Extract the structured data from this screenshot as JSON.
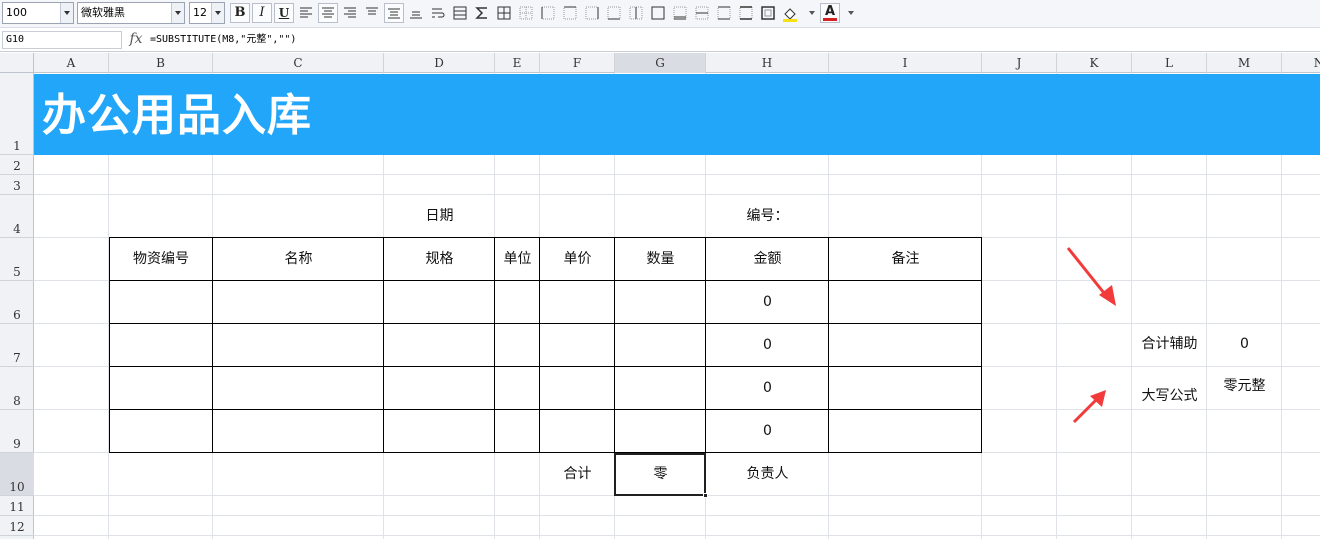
{
  "toolbar": {
    "zoom": "100",
    "font_name": "微软雅黑",
    "font_size": "12",
    "bold_label": "B",
    "italic_label": "I",
    "underline_label": "U",
    "font_color_label": "A"
  },
  "formula_bar": {
    "cell_ref": "G10",
    "fx_label": "fx",
    "formula": "=SUBSTITUTE(M8,\"元整\",\"\")"
  },
  "columns": [
    "A",
    "B",
    "C",
    "D",
    "E",
    "F",
    "G",
    "H",
    "I",
    "J",
    "K",
    "L",
    "M",
    "N"
  ],
  "rows": [
    "1",
    "2",
    "3",
    "4",
    "5",
    "6",
    "7",
    "8",
    "9",
    "10",
    "11",
    "12"
  ],
  "sheet": {
    "title": "办公用品入库",
    "date_label": "日期",
    "number_label": "编号：",
    "headers": [
      "物资编号",
      "名称",
      "规格",
      "单位",
      "单价",
      "数量",
      "金额",
      "备注"
    ],
    "amounts": [
      "0",
      "0",
      "0",
      "0"
    ],
    "total_label": "合计",
    "total_value": "零",
    "person_label": "负责人",
    "helper_label": "合计辅助",
    "helper_value": "0",
    "uppercase_label": "大写公式",
    "uppercase_value": "零元整"
  },
  "colors": {
    "title_band": "#22a6f9",
    "arrow": "#f23a3a",
    "fill_highlight": "#f5e01a",
    "font_color_bar": "#d92020"
  }
}
